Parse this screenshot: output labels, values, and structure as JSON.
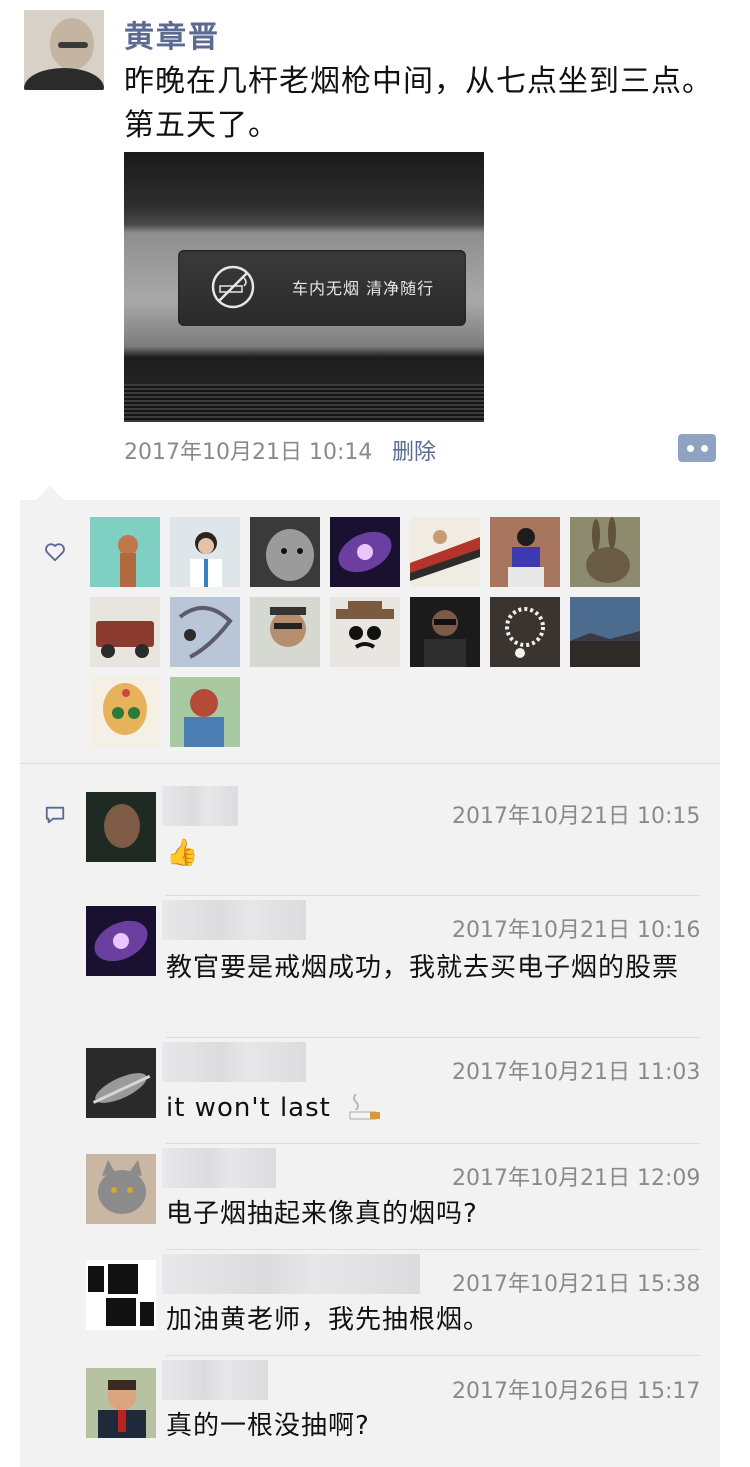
{
  "post": {
    "author": "黄章晋",
    "text": "昨晚在几杆老烟枪中间，从七点坐到三点。第五天了。",
    "photo_sign_text": "车内无烟 清净随行",
    "time": "2017年10月21日 10:14",
    "delete_label": "删除"
  },
  "likes": {
    "count_avatars": 16
  },
  "comments": [
    {
      "time": "2017年10月21日 10:15",
      "text": "👍"
    },
    {
      "time": "2017年10月21日 10:16",
      "text": "教官要是戒烟成功，我就去买电子烟的股票"
    },
    {
      "time": "2017年10月21日 11:03",
      "text": "it won't last"
    },
    {
      "time": "2017年10月21日 12:09",
      "text": "电子烟抽起来像真的烟吗?"
    },
    {
      "time": "2017年10月21日 15:38",
      "text": "加油黄老师，我先抽根烟。"
    },
    {
      "time": "2017年10月26日 15:17",
      "text": "真的一根没抽啊?"
    }
  ],
  "colors": {
    "name_link": "#5b6a91",
    "timestamp": "#8a8a8a",
    "panel_bg": "#f2f2f3"
  },
  "icons": [
    "heart-icon",
    "comment-icon",
    "more-dots-icon",
    "no-smoking-icon",
    "thumbs-up-emoji",
    "cigarette-emoji"
  ]
}
